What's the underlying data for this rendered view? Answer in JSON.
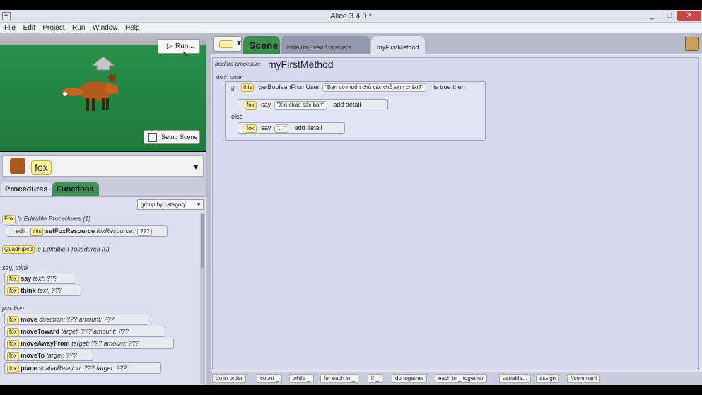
{
  "window": {
    "title": "Alice 3.4.0  *",
    "min": "_",
    "max": "□",
    "close": "✕",
    "app_icon": "java-icon"
  },
  "menu": [
    "File",
    "Edit",
    "Project",
    "Run",
    "Window",
    "Help"
  ],
  "scene": {
    "run_label": "Run...",
    "setup_label": "Setup Scene"
  },
  "selector": {
    "label": "fox",
    "arrow": "▼"
  },
  "tabs": {
    "procedures": "Procedures",
    "functions": "Functions"
  },
  "group_by": {
    "label": "group by category",
    "arrow": "▼"
  },
  "proc_groups": {
    "fox_tile": "Fox",
    "fox_label": "'s Editable Procedures (1)",
    "edit": "edit",
    "this": "this",
    "set_resource": "setFoxResource",
    "set_resource_param": "foxResource:",
    "quadruped_tile": "Quadruped",
    "quadruped_label": "'s Editable Procedures (0)"
  },
  "categories": {
    "say_think": "say, think",
    "position": "position"
  },
  "procedures": [
    {
      "name": "say",
      "params": [
        "text: ???"
      ]
    },
    {
      "name": "think",
      "params": [
        "text: ???"
      ]
    },
    {
      "name": "move",
      "params": [
        "direction: ???",
        "amount: ???"
      ]
    },
    {
      "name": "moveToward",
      "params": [
        "target: ???",
        "amount: ???"
      ]
    },
    {
      "name": "moveAwayFrom",
      "params": [
        "target: ???",
        "amount: ???"
      ]
    },
    {
      "name": "moveTo",
      "params": [
        "target: ???"
      ]
    },
    {
      "name": "place",
      "params": [
        "spatialRelation: ???",
        "target: ???"
      ]
    }
  ],
  "proc_tile": "fox",
  "header": {
    "scene_tab": "Scene",
    "init_tab": "initializeEventListeners",
    "first_tab": "myFirstMethod"
  },
  "code": {
    "declare": "declare procedure",
    "method": "myFirstMethod",
    "do_in_order": "do in order",
    "if_kw": "if",
    "this": "this",
    "get_boolean": "getBooleanFromUser",
    "question": "\"Bạn có muốn chủ các chỗ sinh chào?\"",
    "is_true_then": "is true then",
    "fox": "fox",
    "say": "say",
    "say_text": "\"Xin chào các bạn\"",
    "add_detail": "add detail",
    "else_kw": "else",
    "say_text2": "\"...\""
  },
  "bottom": [
    "do in order",
    "count _",
    "while _",
    "for each in _",
    "if _",
    "do together",
    "each in _ together",
    "variable...",
    "assign",
    "//comment"
  ]
}
